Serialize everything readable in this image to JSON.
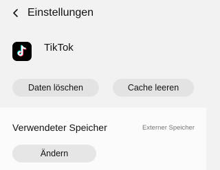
{
  "header": {
    "title": "Einstellungen",
    "back_icon": "chevron-left-icon"
  },
  "app": {
    "name": "TikTok",
    "icon": "tiktok-logo-icon",
    "icon_colors": {
      "background": "#000000",
      "cyan": "#25f4ee",
      "red": "#fe2c55",
      "white": "#ffffff"
    }
  },
  "actions": {
    "clear_data_label": "Daten löschen",
    "clear_cache_label": "Cache leeren"
  },
  "storage": {
    "label": "Verwendeter Speicher",
    "value": "Externer Speicher",
    "change_label": "Ändern"
  },
  "colors": {
    "background": "#f2f2f2",
    "card_background": "#fbfbfb",
    "button_background": "#e3e3e3",
    "text": "#111111",
    "secondary_text": "#777777"
  }
}
